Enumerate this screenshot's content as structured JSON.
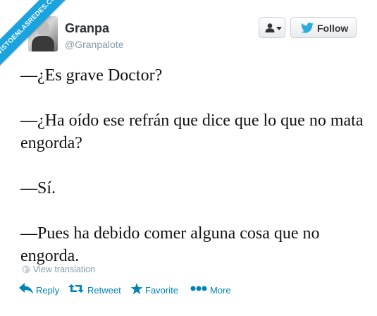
{
  "ribbon": {
    "text": "VISTOENLASREDES.COM"
  },
  "tweet": {
    "author_name": "Granpa",
    "author_handle": "@Granpalote",
    "follow_label": "Follow",
    "lines": [
      "—¿Es grave Doctor?",
      "—¿Ha oído ese refrán que dice que lo que no mata engorda?",
      "—Sí.",
      "—Pues ha debido comer alguna cosa que no engorda."
    ],
    "view_translation": "View translation"
  },
  "actions": {
    "reply": "Reply",
    "retweet": "Retweet",
    "favorite": "Favorite",
    "more": "More"
  },
  "icons": {
    "user_menu": "person-dropdown-icon",
    "follow": "twitter-bird-icon",
    "translation": "globe-icon",
    "reply": "reply-arrow-icon",
    "retweet": "retweet-icon",
    "favorite": "star-icon",
    "more": "ellipsis-icon"
  },
  "colors": {
    "brand_blue": "#0084b4",
    "ribbon_blue": "#1aa3de",
    "handle_gray": "#8899a6",
    "bird_blue": "#2ba9e1"
  }
}
